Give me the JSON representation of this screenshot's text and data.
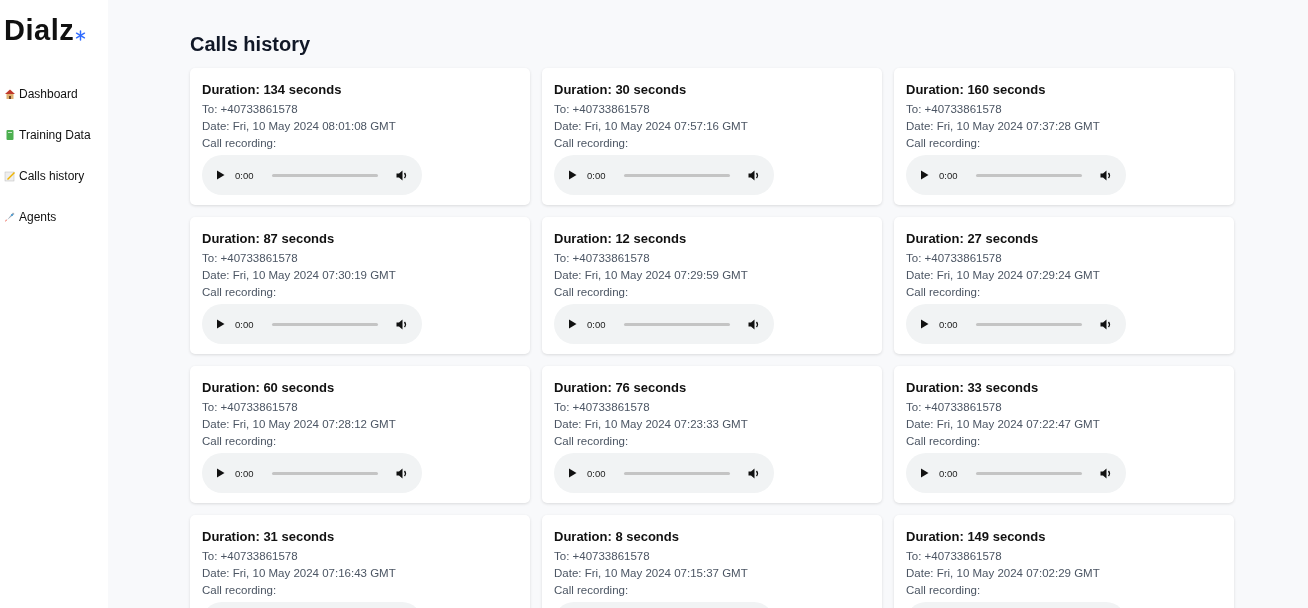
{
  "logo": {
    "text": "Dialz"
  },
  "sidebar": {
    "items": [
      {
        "label": "Dashboard",
        "kind": "house"
      },
      {
        "label": "Training Data",
        "kind": "book"
      },
      {
        "label": "Calls history",
        "kind": "memo"
      },
      {
        "label": "Agents",
        "kind": "rocket"
      }
    ]
  },
  "page_title": "Calls history",
  "calls": [
    {
      "duration": "Duration: 134 seconds",
      "to": "To: +40733861578",
      "date": "Date: Fri, 10 May 2024 08:01:08 GMT",
      "recording_label": "Call recording:",
      "time": "0:00"
    },
    {
      "duration": "Duration: 30 seconds",
      "to": "To: +40733861578",
      "date": "Date: Fri, 10 May 2024 07:57:16 GMT",
      "recording_label": "Call recording:",
      "time": "0:00"
    },
    {
      "duration": "Duration: 160 seconds",
      "to": "To: +40733861578",
      "date": "Date: Fri, 10 May 2024 07:37:28 GMT",
      "recording_label": "Call recording:",
      "time": "0:00"
    },
    {
      "duration": "Duration: 87 seconds",
      "to": "To: +40733861578",
      "date": "Date: Fri, 10 May 2024 07:30:19 GMT",
      "recording_label": "Call recording:",
      "time": "0:00"
    },
    {
      "duration": "Duration: 12 seconds",
      "to": "To: +40733861578",
      "date": "Date: Fri, 10 May 2024 07:29:59 GMT",
      "recording_label": "Call recording:",
      "time": "0:00"
    },
    {
      "duration": "Duration: 27 seconds",
      "to": "To: +40733861578",
      "date": "Date: Fri, 10 May 2024 07:29:24 GMT",
      "recording_label": "Call recording:",
      "time": "0:00"
    },
    {
      "duration": "Duration: 60 seconds",
      "to": "To: +40733861578",
      "date": "Date: Fri, 10 May 2024 07:28:12 GMT",
      "recording_label": "Call recording:",
      "time": "0:00"
    },
    {
      "duration": "Duration: 76 seconds",
      "to": "To: +40733861578",
      "date": "Date: Fri, 10 May 2024 07:23:33 GMT",
      "recording_label": "Call recording:",
      "time": "0:00"
    },
    {
      "duration": "Duration: 33 seconds",
      "to": "To: +40733861578",
      "date": "Date: Fri, 10 May 2024 07:22:47 GMT",
      "recording_label": "Call recording:",
      "time": "0:00"
    },
    {
      "duration": "Duration: 31 seconds",
      "to": "To: +40733861578",
      "date": "Date: Fri, 10 May 2024 07:16:43 GMT",
      "recording_label": "Call recording:"
    },
    {
      "duration": "Duration: 8 seconds",
      "to": "To: +40733861578",
      "date": "Date: Fri, 10 May 2024 07:15:37 GMT",
      "recording_label": "Call recording:"
    },
    {
      "duration": "Duration: 149 seconds",
      "to": "To: +40733861578",
      "date": "Date: Fri, 10 May 2024 07:02:29 GMT",
      "recording_label": "Call recording:"
    }
  ]
}
